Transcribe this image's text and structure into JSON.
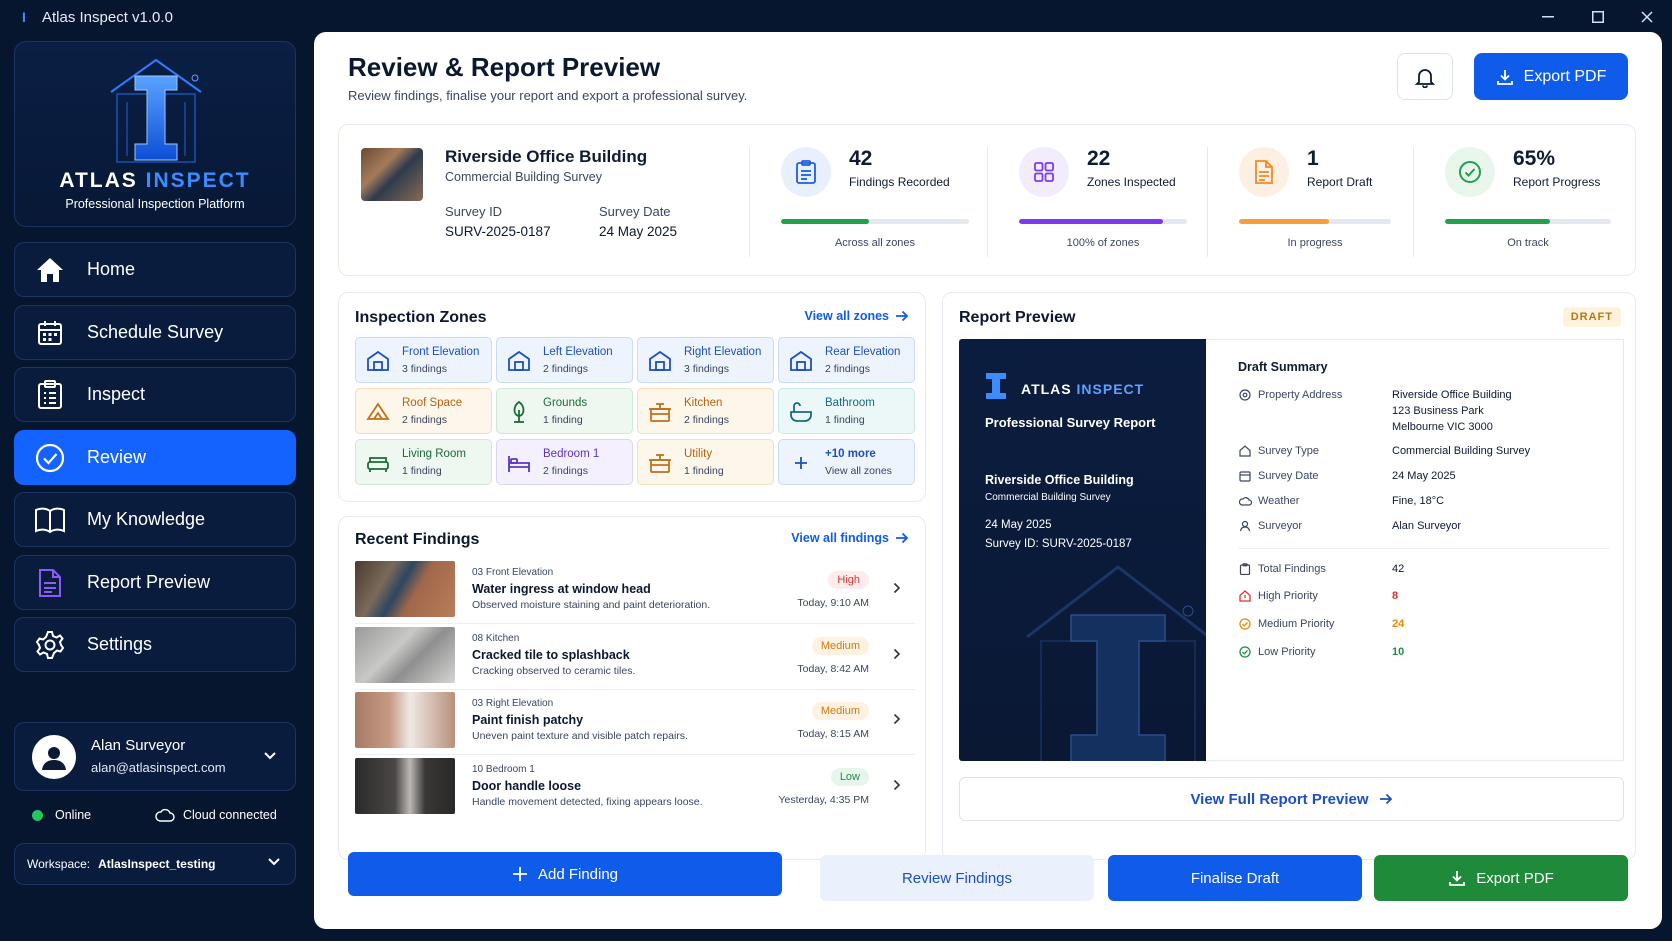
{
  "window": {
    "title": "Atlas Inspect v1.0.0"
  },
  "brand": {
    "name_a": "ATLAS",
    "name_b": "INSPECT",
    "tagline": "Professional Inspection Platform"
  },
  "nav": [
    {
      "label": "Home"
    },
    {
      "label": "Schedule Survey"
    },
    {
      "label": "Inspect"
    },
    {
      "label": "Review"
    },
    {
      "label": "My Knowledge"
    },
    {
      "label": "Report Preview"
    },
    {
      "label": "Settings"
    }
  ],
  "user": {
    "name": "Alan Surveyor",
    "email": "alan@atlasinspect.com"
  },
  "status": {
    "online": "Online",
    "cloud": "Cloud connected"
  },
  "workspace": {
    "label": "Workspace:",
    "value": "AtlasInspect_testing"
  },
  "header": {
    "title": "Review & Report Preview",
    "subtitle": "Review findings, finalise your report and export a professional survey.",
    "export_label": "Export PDF"
  },
  "property": {
    "name": "Riverside Office Building",
    "type": "Commercial Building Survey",
    "survey_id_label": "Survey ID",
    "survey_id": "SURV-2025-0187",
    "survey_date_label": "Survey Date",
    "survey_date": "24 May 2025"
  },
  "stats": [
    {
      "value": "42",
      "label": "Findings Recorded",
      "foot": "Across all zones",
      "progress": 0.47,
      "color": "#22a04b"
    },
    {
      "value": "22",
      "label": "Zones Inspected",
      "foot": "100% of zones",
      "progress": 0.86,
      "color": "#7c3aed"
    },
    {
      "value": "1",
      "label": "Report Draft",
      "foot": "In progress",
      "progress": 0.59,
      "color": "#f59e3c"
    },
    {
      "value": "65%",
      "label": "Report Progress",
      "foot": "On track",
      "progress": 0.63,
      "color": "#22a04b"
    }
  ],
  "zones": {
    "title": "Inspection Zones",
    "view_all": "View all zones",
    "items": [
      {
        "name": "Front Elevation",
        "count": "3 findings"
      },
      {
        "name": "Left Elevation",
        "count": "2 findings"
      },
      {
        "name": "Right Elevation",
        "count": "3 findings"
      },
      {
        "name": "Rear Elevation",
        "count": "2 findings"
      },
      {
        "name": "Roof Space",
        "count": "2 findings"
      },
      {
        "name": "Grounds",
        "count": "1 finding"
      },
      {
        "name": "Kitchen",
        "count": "2 findings"
      },
      {
        "name": "Bathroom",
        "count": "1 finding"
      },
      {
        "name": "Living Room",
        "count": "1 finding"
      },
      {
        "name": "Bedroom 1",
        "count": "2 findings"
      },
      {
        "name": "Utility",
        "count": "1 finding"
      },
      {
        "name": "+10 more",
        "count": "View all zones"
      }
    ]
  },
  "findings": {
    "title": "Recent Findings",
    "view_all": "View all findings",
    "items": [
      {
        "location": "03 Front Elevation",
        "title": "Water ingress at window head",
        "desc": "Observed moisture staining and paint deterioration.",
        "priority": "High",
        "time": "Today, 9:10 AM"
      },
      {
        "location": "08 Kitchen",
        "title": "Cracked tile to splashback",
        "desc": "Cracking observed to ceramic tiles.",
        "priority": "Medium",
        "time": "Today, 8:42 AM"
      },
      {
        "location": "03 Right Elevation",
        "title": "Paint finish patchy",
        "desc": "Uneven paint texture and visible patch repairs.",
        "priority": "Medium",
        "time": "Today, 8:15 AM"
      },
      {
        "location": "10 Bedroom 1",
        "title": "Door handle loose",
        "desc": "Handle movement detected, fixing appears loose.",
        "priority": "Low",
        "time": "Yesterday, 4:35 PM"
      }
    ]
  },
  "preview": {
    "title": "Report Preview",
    "badge": "DRAFT",
    "cover": {
      "brand_a": "ATLAS",
      "brand_b": "INSPECT",
      "report_title": "Professional Survey Report",
      "property": "Riverside Office Building",
      "type": "Commercial Building Survey",
      "date": "24 May 2025",
      "survey_id": "Survey ID: SURV-2025-0187"
    },
    "summary_title": "Draft Summary",
    "rows": [
      {
        "label": "Property Address",
        "value": "Riverside Office Building"
      },
      {
        "label": "Survey Type",
        "value": "Commercial Building Survey"
      },
      {
        "label": "Survey Date",
        "value": "24 May 2025"
      },
      {
        "label": "Weather",
        "value": "Fine, 18°C"
      },
      {
        "label": "Surveyor",
        "value": "Alan Surveyor"
      }
    ],
    "address_line2": "123 Business Park",
    "address_line3": "Melbourne VIC 3000",
    "totals": [
      {
        "label": "Total Findings",
        "value": "42",
        "color": "#0c1730"
      },
      {
        "label": "High Priority",
        "value": "8",
        "color": "#e03131"
      },
      {
        "label": "Medium Priority",
        "value": "24",
        "color": "#e8890c"
      },
      {
        "label": "Low Priority",
        "value": "10",
        "color": "#238a49"
      }
    ],
    "view_full": "View Full Report Preview"
  },
  "actions": {
    "add_finding": "Add Finding",
    "review_findings": "Review Findings",
    "finalise_draft": "Finalise Draft",
    "export_pdf": "Export PDF"
  }
}
